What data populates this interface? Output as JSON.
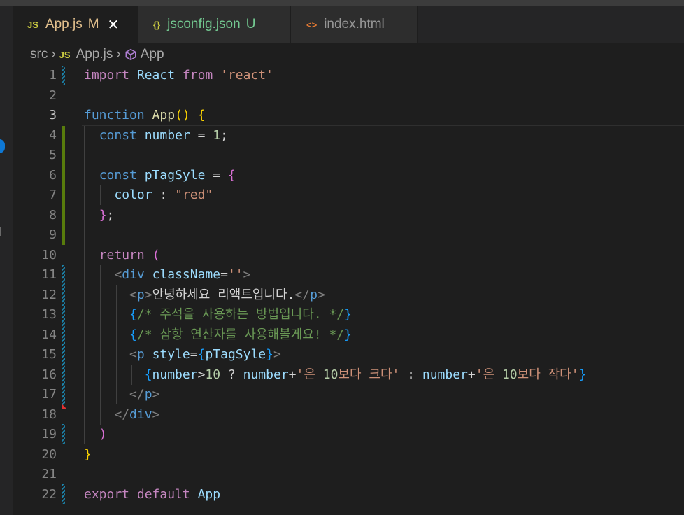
{
  "tabs": [
    {
      "icon": "JS",
      "label": "App.js",
      "status": "M",
      "close": "✕"
    },
    {
      "icon": "{}",
      "label": "jsconfig.json",
      "status": "U"
    },
    {
      "icon": "<>",
      "label": "index.html"
    }
  ],
  "breadcrumb": {
    "folder": "src",
    "file": "App.js",
    "file_icon": "JS",
    "symbol": "App"
  },
  "colors": {
    "accent_badge": "#0e78d5",
    "modified_gutter": "#1b81a8",
    "added_gutter": "#587c0c"
  },
  "lines": [
    {
      "n": "1",
      "tokens": [
        [
          "import",
          "kw2"
        ],
        [
          " ",
          "pun"
        ],
        [
          "React",
          "var"
        ],
        [
          " ",
          "pun"
        ],
        [
          "from",
          "kw2"
        ],
        [
          " ",
          "pun"
        ],
        [
          "'react'",
          "str"
        ]
      ]
    },
    {
      "n": "2",
      "tokens": []
    },
    {
      "n": "3",
      "tokens": [
        [
          "function",
          "kw"
        ],
        [
          " ",
          "pun"
        ],
        [
          "App",
          "fn"
        ],
        [
          "()",
          "br1"
        ],
        [
          " ",
          "pun"
        ],
        [
          "{",
          "br1"
        ]
      ]
    },
    {
      "n": "4",
      "tokens": [
        [
          "  ",
          "pun"
        ],
        [
          "const",
          "kw"
        ],
        [
          " ",
          "pun"
        ],
        [
          "number",
          "var"
        ],
        [
          " = ",
          "pun"
        ],
        [
          "1",
          "num"
        ],
        [
          ";",
          "pun"
        ]
      ]
    },
    {
      "n": "5",
      "tokens": []
    },
    {
      "n": "6",
      "tokens": [
        [
          "  ",
          "pun"
        ],
        [
          "const",
          "kw"
        ],
        [
          " ",
          "pun"
        ],
        [
          "pTagSyle",
          "var"
        ],
        [
          " = ",
          "pun"
        ],
        [
          "{",
          "br2"
        ]
      ]
    },
    {
      "n": "7",
      "tokens": [
        [
          "    ",
          "pun"
        ],
        [
          "color",
          "var"
        ],
        [
          " : ",
          "pun"
        ],
        [
          "\"red\"",
          "str"
        ]
      ]
    },
    {
      "n": "8",
      "tokens": [
        [
          "  ",
          "pun"
        ],
        [
          "}",
          "br2"
        ],
        [
          ";",
          "pun"
        ]
      ]
    },
    {
      "n": "9",
      "tokens": []
    },
    {
      "n": "10",
      "tokens": [
        [
          "  ",
          "pun"
        ],
        [
          "return",
          "kw2"
        ],
        [
          " ",
          "pun"
        ],
        [
          "(",
          "br2"
        ]
      ]
    },
    {
      "n": "11",
      "tokens": [
        [
          "    ",
          "pun"
        ],
        [
          "<",
          "tgb"
        ],
        [
          "div",
          "tag"
        ],
        [
          " ",
          "pun"
        ],
        [
          "className",
          "attr"
        ],
        [
          "=",
          "pun"
        ],
        [
          "''",
          "str"
        ],
        [
          ">",
          "tgb"
        ]
      ]
    },
    {
      "n": "12",
      "tokens": [
        [
          "      ",
          "pun"
        ],
        [
          "<",
          "tgb"
        ],
        [
          "p",
          "tag"
        ],
        [
          ">",
          "tgb"
        ],
        [
          "안녕하세요 리액트입니다.",
          "jsx"
        ],
        [
          "</",
          "tgb"
        ],
        [
          "p",
          "tag"
        ],
        [
          ">",
          "tgb"
        ]
      ]
    },
    {
      "n": "13",
      "tokens": [
        [
          "      ",
          "pun"
        ],
        [
          "{",
          "br3"
        ],
        [
          "/* 주석을 사용하는 방법입니다. */",
          "cmt"
        ],
        [
          "}",
          "br3"
        ]
      ]
    },
    {
      "n": "14",
      "tokens": [
        [
          "      ",
          "pun"
        ],
        [
          "{",
          "br3"
        ],
        [
          "/* 삼항 연산자를 사용해볼게요! */",
          "cmt"
        ],
        [
          "}",
          "br3"
        ]
      ]
    },
    {
      "n": "15",
      "tokens": [
        [
          "      ",
          "pun"
        ],
        [
          "<",
          "tgb"
        ],
        [
          "p",
          "tag"
        ],
        [
          " ",
          "pun"
        ],
        [
          "style",
          "attr"
        ],
        [
          "=",
          "pun"
        ],
        [
          "{",
          "br3"
        ],
        [
          "pTagSyle",
          "var"
        ],
        [
          "}",
          "br3"
        ],
        [
          ">",
          "tgb"
        ]
      ]
    },
    {
      "n": "16",
      "tokens": [
        [
          "        ",
          "pun"
        ],
        [
          "{",
          "br3"
        ],
        [
          "number",
          "var"
        ],
        [
          ">",
          "pun"
        ],
        [
          "10",
          "num"
        ],
        [
          " ? ",
          "pun"
        ],
        [
          "number",
          "var"
        ],
        [
          "+",
          "pun"
        ],
        [
          "'은 ",
          "str"
        ],
        [
          "10",
          "num"
        ],
        [
          "보다 크다'",
          "str"
        ],
        [
          " : ",
          "pun"
        ],
        [
          "number",
          "var"
        ],
        [
          "+",
          "pun"
        ],
        [
          "'은 ",
          "str"
        ],
        [
          "10",
          "num"
        ],
        [
          "보다 작다'",
          "str"
        ],
        [
          "}",
          "br3"
        ]
      ]
    },
    {
      "n": "17",
      "tokens": [
        [
          "      ",
          "pun"
        ],
        [
          "</",
          "tgb"
        ],
        [
          "p",
          "tag"
        ],
        [
          ">",
          "tgb"
        ]
      ]
    },
    {
      "n": "18",
      "tokens": [
        [
          "    ",
          "pun"
        ],
        [
          "</",
          "tgb"
        ],
        [
          "div",
          "tag"
        ],
        [
          ">",
          "tgb"
        ]
      ]
    },
    {
      "n": "19",
      "tokens": [
        [
          "  ",
          "pun"
        ],
        [
          ")",
          "br2"
        ]
      ]
    },
    {
      "n": "20",
      "tokens": [
        [
          "}",
          "br1"
        ]
      ]
    },
    {
      "n": "21",
      "tokens": []
    },
    {
      "n": "22",
      "tokens": [
        [
          "export",
          "kw2"
        ],
        [
          " ",
          "pun"
        ],
        [
          "default",
          "kw2"
        ],
        [
          " ",
          "pun"
        ],
        [
          "App",
          "var"
        ]
      ]
    }
  ]
}
